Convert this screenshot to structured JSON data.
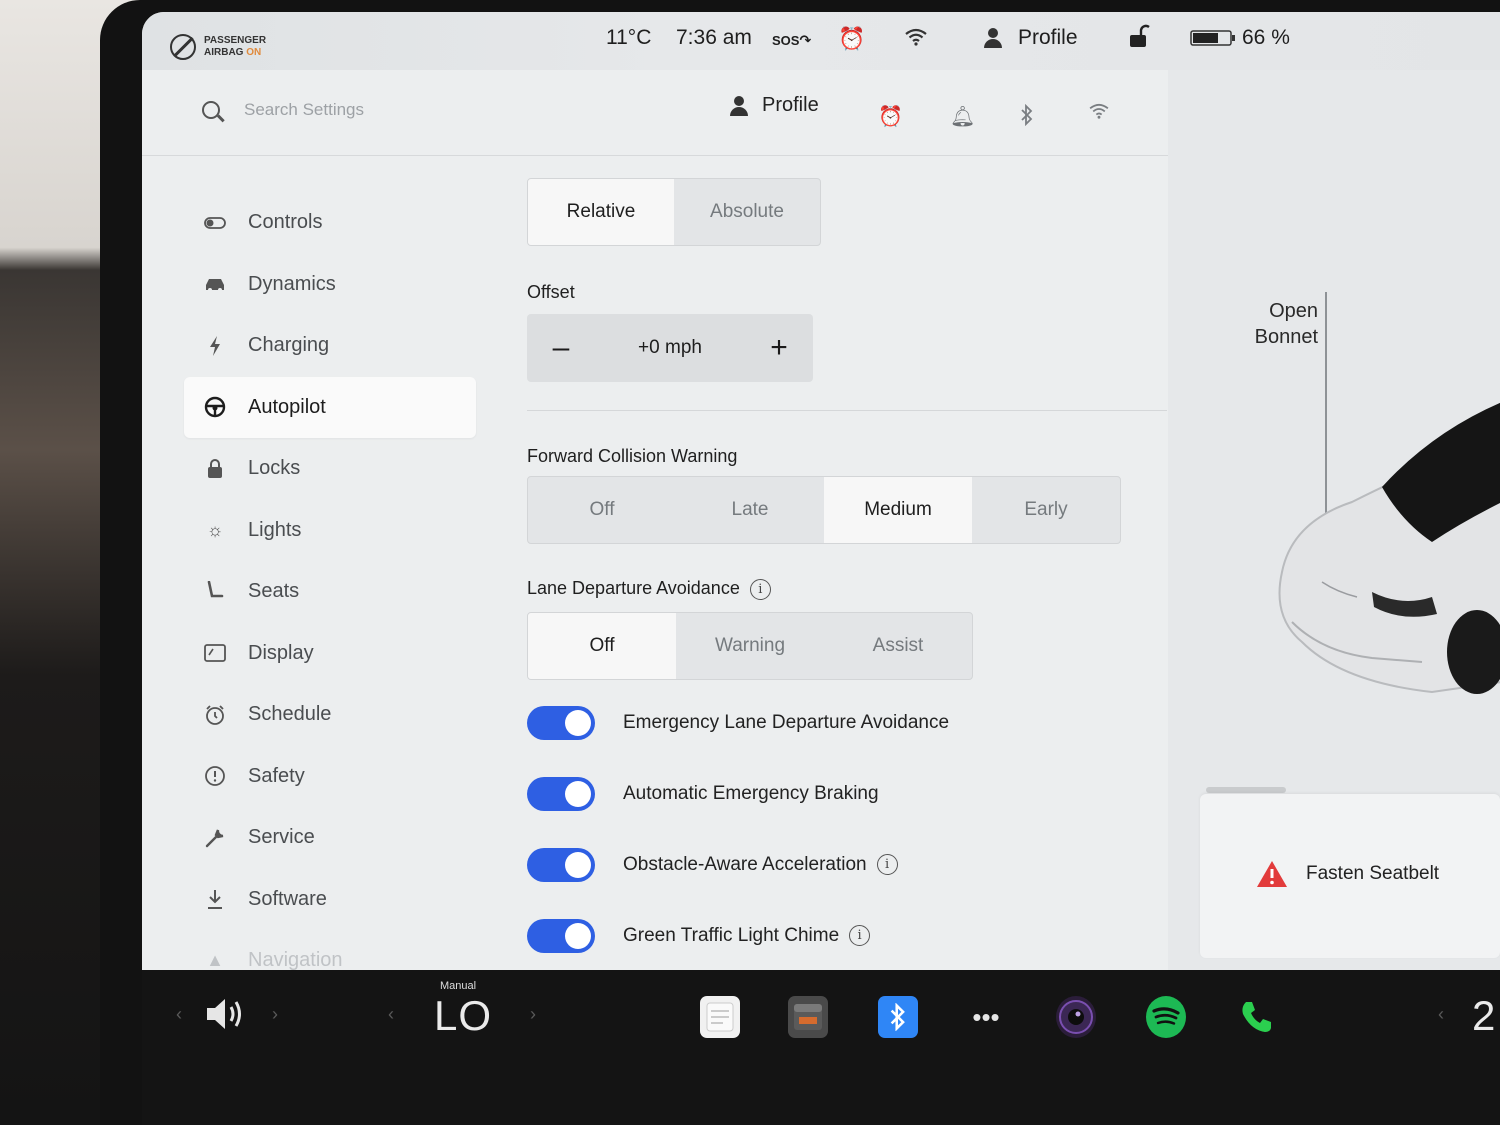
{
  "status_bar": {
    "airbag_line1": "PASSENGER",
    "airbag_line2": "AIRBAG",
    "airbag_state": "ON",
    "temperature": "11°C",
    "time": "7:36 am",
    "sos": "SOS",
    "profile": "Profile",
    "battery": "66 %"
  },
  "header": {
    "search_placeholder": "Search Settings",
    "profile": "Profile"
  },
  "sidebar": {
    "items": [
      {
        "label": "Controls",
        "icon": "toggle-icon"
      },
      {
        "label": "Dynamics",
        "icon": "car-icon"
      },
      {
        "label": "Charging",
        "icon": "bolt-icon"
      },
      {
        "label": "Autopilot",
        "icon": "steering-wheel-icon",
        "active": true
      },
      {
        "label": "Locks",
        "icon": "lock-icon"
      },
      {
        "label": "Lights",
        "icon": "sun-icon"
      },
      {
        "label": "Seats",
        "icon": "seat-icon"
      },
      {
        "label": "Display",
        "icon": "display-icon"
      },
      {
        "label": "Schedule",
        "icon": "clock-icon"
      },
      {
        "label": "Safety",
        "icon": "alert-circle-icon"
      },
      {
        "label": "Service",
        "icon": "wrench-icon"
      },
      {
        "label": "Software",
        "icon": "download-icon"
      },
      {
        "label": "Navigation",
        "icon": "nav-arrow-icon"
      }
    ]
  },
  "autopilot": {
    "speed_limit_mode": {
      "options": [
        "Relative",
        "Absolute"
      ],
      "selected": "Relative"
    },
    "offset_label": "Offset",
    "offset_value": "+0 mph",
    "fcw": {
      "label": "Forward Collision Warning",
      "options": [
        "Off",
        "Late",
        "Medium",
        "Early"
      ],
      "selected": "Medium"
    },
    "lda": {
      "label": "Lane Departure Avoidance",
      "options": [
        "Off",
        "Warning",
        "Assist"
      ],
      "selected": "Off"
    },
    "toggles": [
      {
        "label": "Emergency Lane Departure Avoidance",
        "on": true,
        "info": false
      },
      {
        "label": "Automatic Emergency Braking",
        "on": true,
        "info": false
      },
      {
        "label": "Obstacle-Aware Acceleration",
        "on": true,
        "info": true
      },
      {
        "label": "Green Traffic Light Chime",
        "on": true,
        "info": true
      }
    ]
  },
  "car_panel": {
    "bonnet_line1": "Open",
    "bonnet_line2": "Bonnet",
    "alert": "Fasten Seatbelt"
  },
  "dock": {
    "climate_mode": "Manual",
    "climate_temp": "LO",
    "right_temp_partial": "2"
  },
  "colors": {
    "accent_toggle": "#2e5fe3",
    "warning_red": "#e23b3b",
    "spotify_green": "#1db954",
    "phone_green": "#2bcf4f",
    "bluetooth_blue": "#2f86f6"
  }
}
